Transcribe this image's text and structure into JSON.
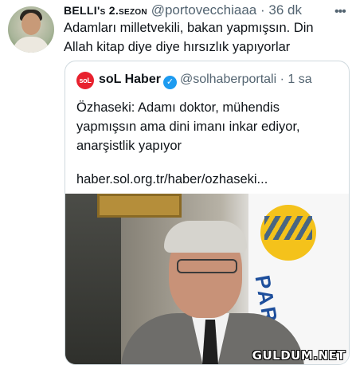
{
  "tweet": {
    "author_name": "BELLI's 2.sezon",
    "author_handle": "@portovecchiaaa",
    "separator": "·",
    "time": "36 dk",
    "text": "Adamları milletvekili, bakan yapmışsın. Din Allah kitap diye diye hırsızlık yapıyorlar"
  },
  "quoted_tweet": {
    "avatar_text": "soL",
    "author_name": "soL Haber",
    "verified": true,
    "author_handle": "@solhaberportali",
    "separator": "·",
    "time": "1 sa",
    "text": "Özhaseki: Adamı doktor, mühendis yapmışsın ama dini imanı inkar ediyor, anarşistlik yapıyor",
    "link": "haber.sol.org.tr/haber/ozhaseki..."
  },
  "media": {
    "logo_text": "PARTİ",
    "watermark": "GULDUM.NET"
  },
  "icons": {
    "more": "more-icon",
    "verified": "verified-icon"
  },
  "colors": {
    "text": "#0f1419",
    "secondary": "#536471",
    "verified": "#1d9bf0",
    "border": "#cfd9de",
    "sol_red": "#e8212e"
  }
}
